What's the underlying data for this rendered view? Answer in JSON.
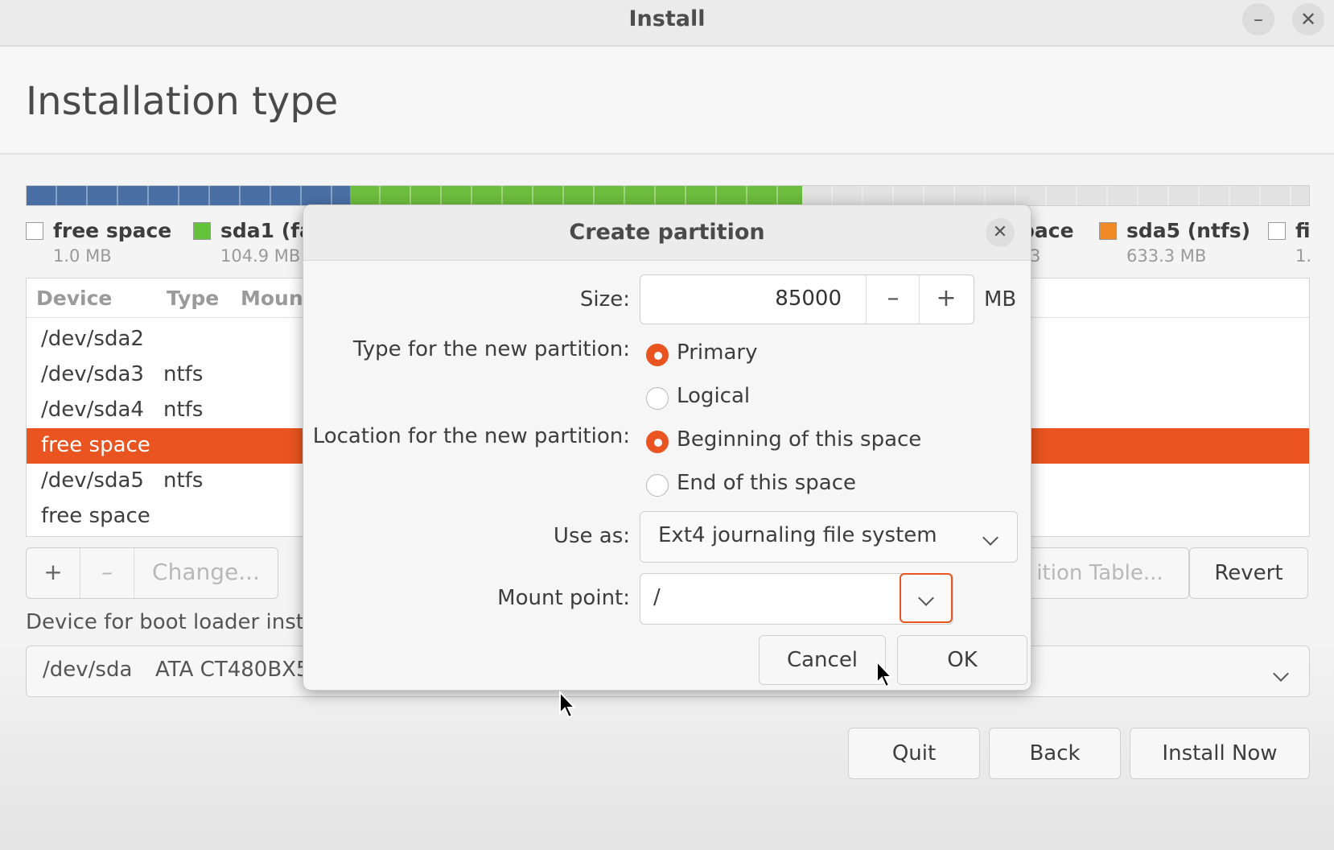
{
  "window": {
    "title": "Install",
    "minimize_label": "–",
    "close_label": "✕"
  },
  "page": {
    "title": "Installation type"
  },
  "legend": [
    {
      "label": "free space",
      "size": "1.0 MB",
      "color": "#ffffff"
    },
    {
      "label": "sda1 (fa",
      "size": "104.9 MB",
      "color": "#65c33b"
    },
    {
      "label": "pace",
      "size": "3",
      "color": ""
    },
    {
      "label": "sda5 (ntfs)",
      "size": "633.3 MB",
      "color": "#f08a24"
    },
    {
      "label": "fi",
      "size": "1.",
      "color": "#ffffff"
    }
  ],
  "partition_bar": {
    "colors": [
      "#4a6fa5",
      "#6dbd3e",
      "#e2e2e2"
    ]
  },
  "table": {
    "headers": {
      "device": "Device",
      "type": "Type",
      "mount": "Moun"
    },
    "rows": [
      {
        "device": "/dev/sda2",
        "type": ""
      },
      {
        "device": "/dev/sda3",
        "type": "ntfs"
      },
      {
        "device": "/dev/sda4",
        "type": "ntfs"
      },
      {
        "device": "free space",
        "type": ""
      },
      {
        "device": "/dev/sda5",
        "type": "ntfs"
      },
      {
        "device": "free space",
        "type": ""
      }
    ]
  },
  "toolbar": {
    "add_label": "+",
    "remove_label": "–",
    "change_label": "Change...",
    "partition_table_label": "ition Table...",
    "revert_label": "Revert"
  },
  "bootloader": {
    "label": "Device for boot loader inst",
    "device": "/dev/sda",
    "model": "ATA CT480BX5"
  },
  "footer": {
    "quit_label": "Quit",
    "back_label": "Back",
    "install_label": "Install Now"
  },
  "dialog": {
    "title": "Create partition",
    "close_label": "✕",
    "size_label": "Size:",
    "size_value": "85000",
    "size_minus": "–",
    "size_plus": "+",
    "size_unit": "MB",
    "type_label": "Type for the new partition:",
    "type_primary": "Primary",
    "type_logical": "Logical",
    "location_label": "Location for the new partition:",
    "location_begin": "Beginning of this space",
    "location_end": "End of this space",
    "use_as_label": "Use as:",
    "use_as_value": "Ext4 journaling file system",
    "mount_label": "Mount point:",
    "mount_value": "/",
    "cancel_label": "Cancel",
    "ok_label": "OK"
  }
}
